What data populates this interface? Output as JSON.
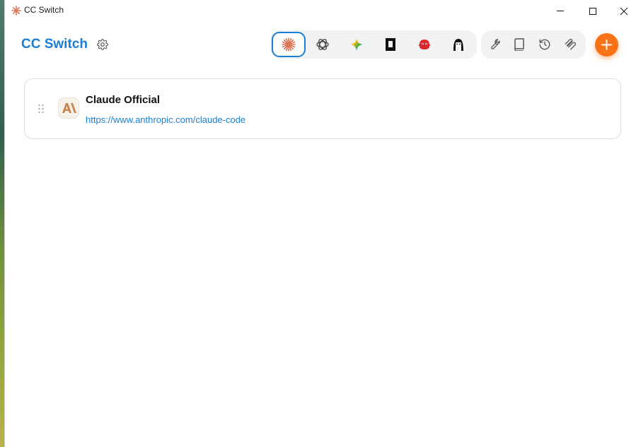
{
  "window": {
    "title": "CC Switch"
  },
  "header": {
    "app_title": "CC Switch",
    "tools": [
      {
        "name": "claude",
        "icon": "claude-asterisk-icon",
        "active": true
      },
      {
        "name": "codex",
        "icon": "openai-knot-icon",
        "active": false
      },
      {
        "name": "gemini",
        "icon": "gemini-sparkle-icon",
        "active": false
      },
      {
        "name": "tool-4",
        "icon": "black-box-icon",
        "active": false
      },
      {
        "name": "tool-5",
        "icon": "red-creature-icon",
        "active": false
      },
      {
        "name": "tool-6",
        "icon": "hooded-character-icon",
        "active": false
      }
    ],
    "actions": [
      "wrench-icon",
      "book-icon",
      "history-icon",
      "mcp-icon"
    ],
    "add_icon": "plus-icon"
  },
  "providers": [
    {
      "name": "Claude Official",
      "url": "https://www.anthropic.com/claude-code",
      "logo": "anthropic-logo-icon"
    }
  ],
  "colors": {
    "accent": "#1a7fd4",
    "add_button": "#f97316",
    "claude": "#d97757"
  }
}
